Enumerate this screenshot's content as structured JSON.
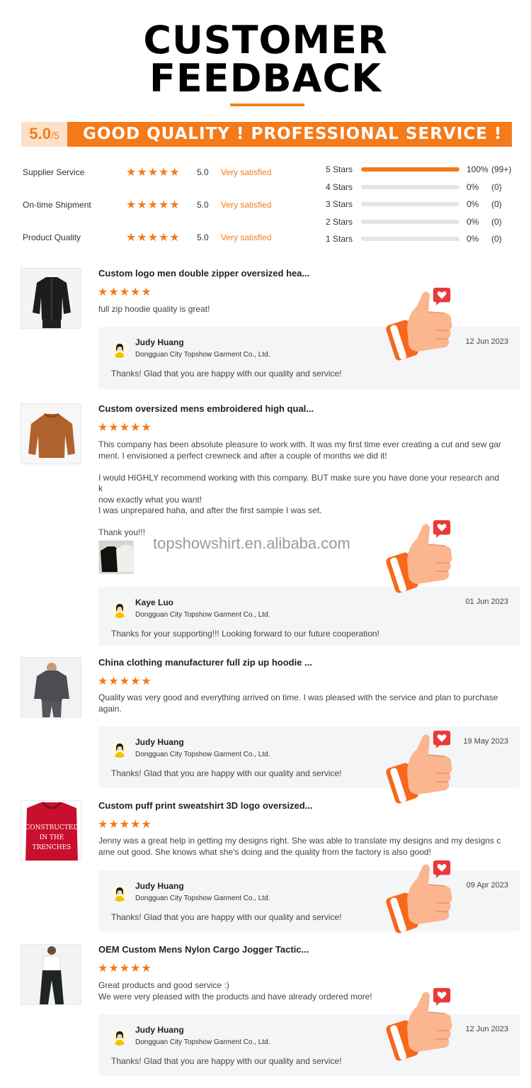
{
  "header": {
    "title_line1": "CUSTOMER",
    "title_line2": "FEEDBACK"
  },
  "score": {
    "value": "5.0",
    "max": "/5",
    "banner": "GOOD QUALITY ! PROFESSIONAL SERVICE !"
  },
  "metrics": [
    {
      "label": "Supplier Service",
      "stars": "★★★★★",
      "score": "5.0",
      "text": "Very satisfied"
    },
    {
      "label": "On-time Shipment",
      "stars": "★★★★★",
      "score": "5.0",
      "text": "Very satisfied"
    },
    {
      "label": "Product Quality",
      "stars": "★★★★★",
      "score": "5.0",
      "text": "Very satisfied"
    }
  ],
  "distribution": [
    {
      "label": "5 Stars",
      "pct": "100%",
      "count": "(99+)",
      "fill": 1.0
    },
    {
      "label": "4 Stars",
      "pct": "0%",
      "count": "(0)",
      "fill": 0
    },
    {
      "label": "3 Stars",
      "pct": "0%",
      "count": "(0)",
      "fill": 0
    },
    {
      "label": "2 Stars",
      "pct": "0%",
      "count": "(0)",
      "fill": 0
    },
    {
      "label": "1 Stars",
      "pct": "0%",
      "count": "(0)",
      "fill": 0
    }
  ],
  "watermark": "topshowshirt.en.alibaba.com",
  "reviews": [
    {
      "title": "Custom logo men double zipper oversized hea...",
      "stars": "★★★★★",
      "body": [
        "full zip hoodie quality is great!"
      ],
      "reply": {
        "name": "Judy Huang",
        "company": "Dongguan City Topshow Garment Co., Ltd.",
        "date": "12 Jun 2023",
        "text": "Thanks!  Glad that you are happy with our quality and service!"
      }
    },
    {
      "title": "Custom oversized mens embroidered high qual...",
      "stars": "★★★★★",
      "body": [
        "This company has been absolute pleasure to work with. It was my first time ever creating a cut and sew gar",
        "ment. I envisioned a perfect crewneck and after a couple of months we did it!",
        "",
        "I would HIGHLY recommend working with this company. BUT make sure you have done your research and k",
        "now exactly what you want!",
        "I was unprepared haha, and after the first sample I was set.",
        "",
        "Thank you!!!"
      ],
      "reply": {
        "name": "Kaye Luo",
        "company": "Dongguan City Topshow Garment Co., Ltd.",
        "date": "01 Jun 2023",
        "text": "Thanks for your supporting!!! Looking forward to our future cooperation!"
      }
    },
    {
      "title": "China clothing manufacturer full zip up hoodie ...",
      "stars": "★★★★★",
      "body": [
        "Quality was very good and everything arrived on time. I was pleased with the service and plan to purchase",
        "again."
      ],
      "reply": {
        "name": "Judy Huang",
        "company": "Dongguan City Topshow Garment Co., Ltd.",
        "date": "19 May 2023",
        "text": "Thanks!  Glad that you are happy with our quality and service!"
      }
    },
    {
      "title": "Custom puff print sweatshirt 3D logo oversized...",
      "stars": "★★★★★",
      "body": [
        "Jenny was a great help in getting my designs right. She was able to translate my designs and my designs c",
        "ame out good. She knows what she's doing and the quality from the factory is also good!"
      ],
      "reply": {
        "name": "Judy Huang",
        "company": "Dongguan City Topshow Garment Co., Ltd.",
        "date": "09 Apr 2023",
        "text": "Thanks!  Glad that you are happy with our quality and service!"
      }
    },
    {
      "title": "OEM Custom Mens Nylon Cargo Jogger Tactic...",
      "stars": "★★★★★",
      "body": [
        "Great products and good service :)",
        "We were very pleased with the products and have already ordered more!"
      ],
      "reply": {
        "name": "Judy Huang",
        "company": "Dongguan City Topshow Garment Co., Ltd.",
        "date": "12 Jun 2023",
        "text": "Thanks!  Glad that you are happy with our quality and service!"
      }
    }
  ],
  "colors": {
    "accent": "#f47a1a",
    "accent_light": "#fde0c8",
    "reply_bg": "#f4f5f7"
  },
  "icons": [
    "star-icon",
    "thumbs-up-icon",
    "heart-icon",
    "avatar-icon"
  ]
}
